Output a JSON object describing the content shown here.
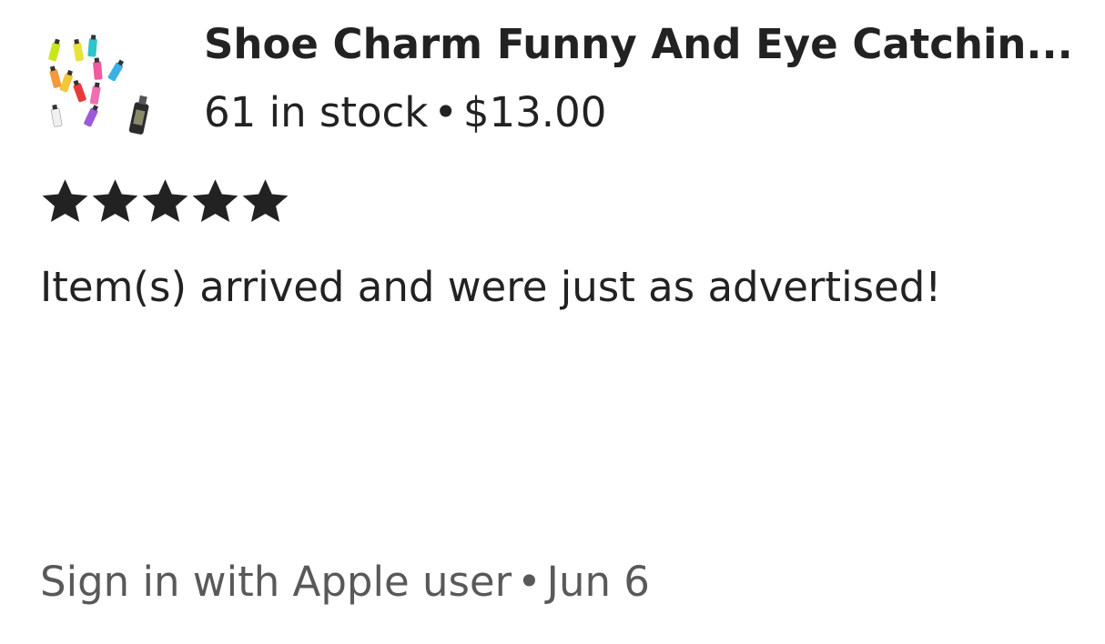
{
  "listing": {
    "thumbnail_icon": "product-thumbnail-image",
    "title": "Shoe Charm Funny And Eye Catchin...",
    "stock_text": "61 in stock",
    "separator": "•",
    "price": "$13.00"
  },
  "review": {
    "rating": 5,
    "rating_max": 5,
    "star_icon": "star-icon",
    "star_color": "#222222",
    "text": "Item(s) arrived and were just as advertised!"
  },
  "byline": {
    "author": "Sign in with Apple user",
    "separator": "•",
    "date": "Jun 6"
  }
}
